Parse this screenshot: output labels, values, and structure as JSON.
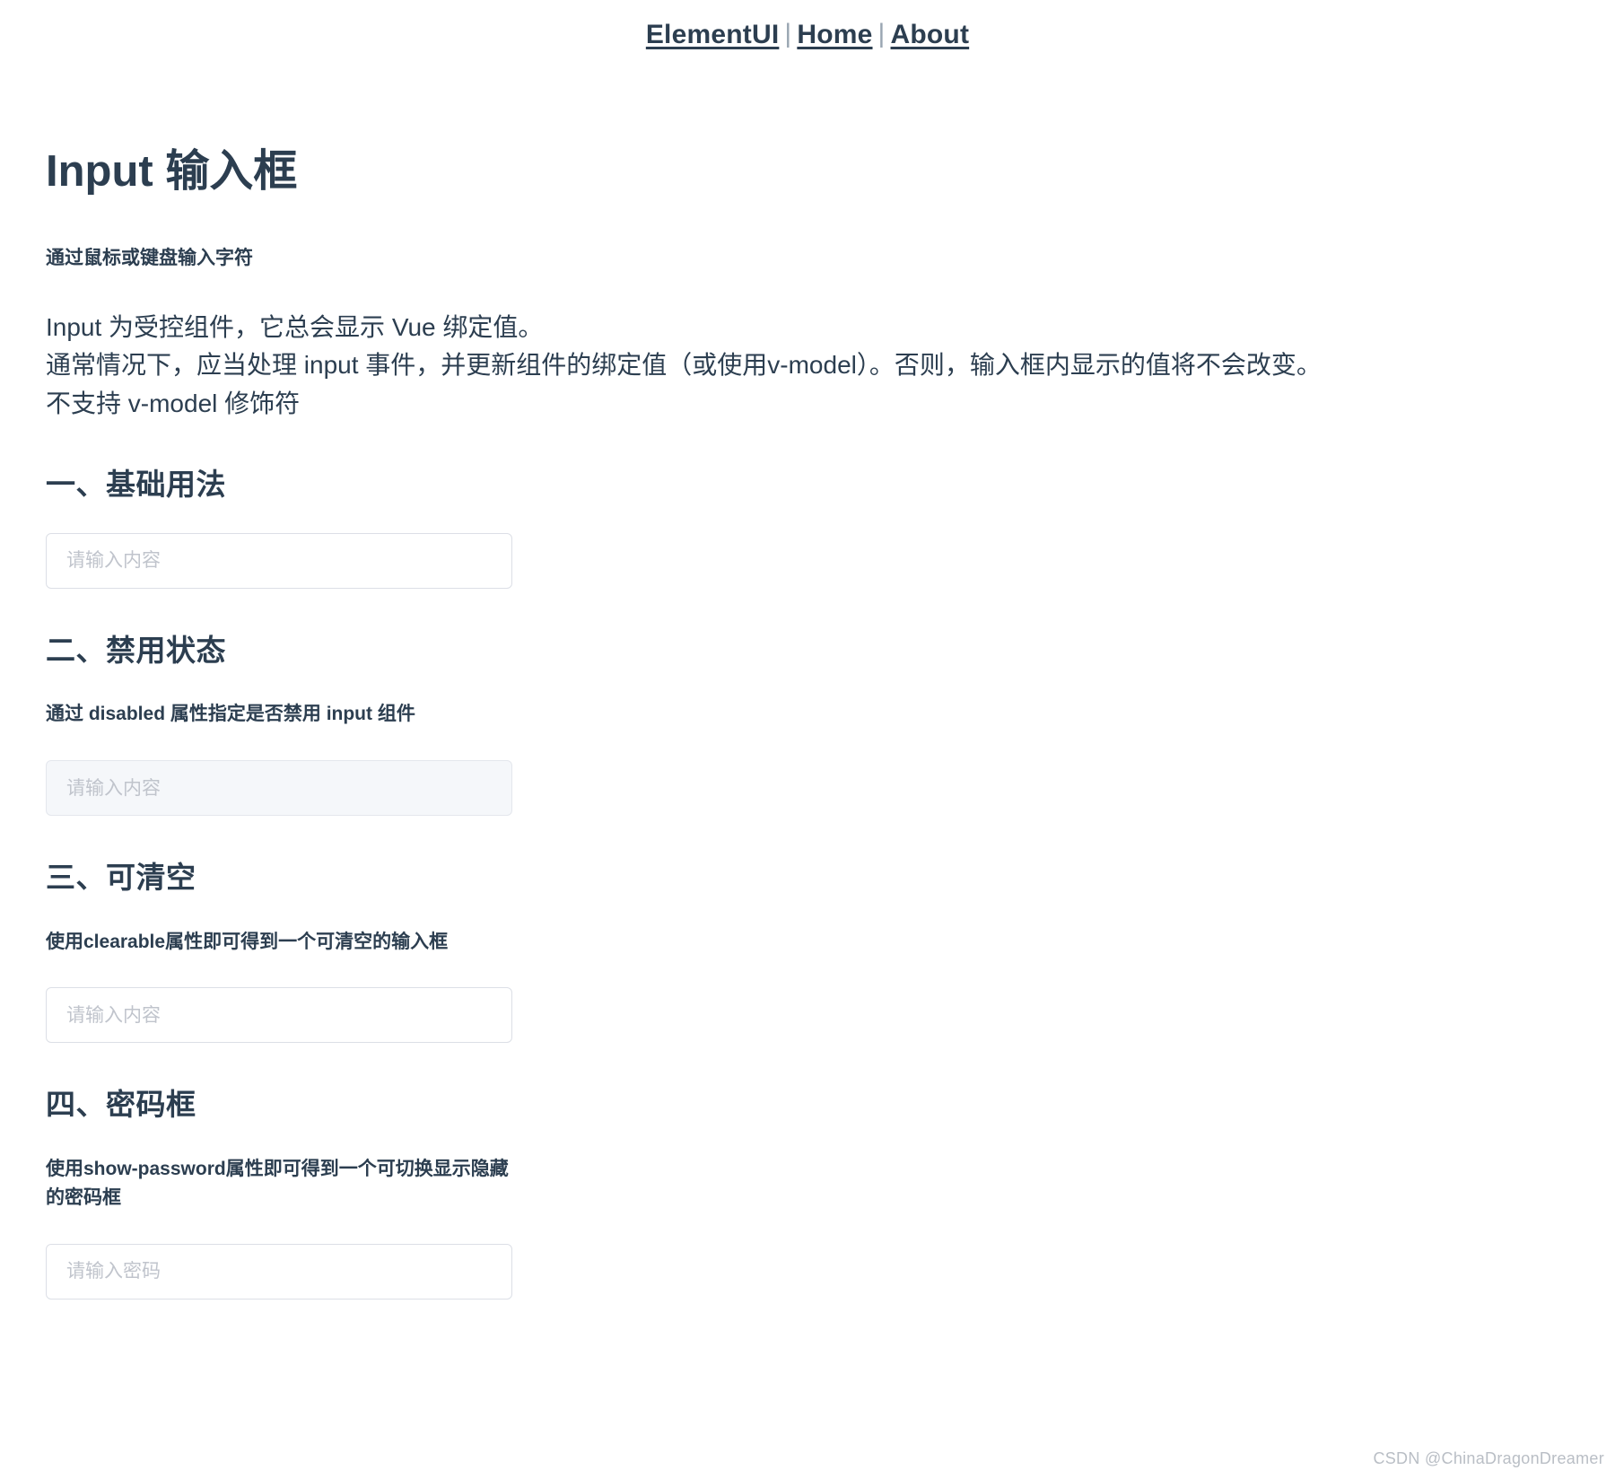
{
  "nav": {
    "separator": "|",
    "links": [
      {
        "label": "ElementUI"
      },
      {
        "label": "Home"
      },
      {
        "label": "About"
      }
    ]
  },
  "page": {
    "title": "Input 输入框",
    "lead": "通过鼠标或键盘输入字符",
    "description_lines": [
      "Input 为受控组件，它总会显示 Vue 绑定值。",
      "通常情况下，应当处理 input 事件，并更新组件的绑定值（或使用v-model）。否则，输入框内显示的值将不会改变。",
      "不支持 v-model 修饰符"
    ]
  },
  "sections": [
    {
      "title": "一、基础用法",
      "description": "",
      "input": {
        "placeholder": "请输入内容",
        "value": "",
        "disabled": false
      }
    },
    {
      "title": "二、禁用状态",
      "description": "通过 disabled 属性指定是否禁用 input 组件",
      "input": {
        "placeholder": "请输入内容",
        "value": "",
        "disabled": true
      }
    },
    {
      "title": "三、可清空",
      "description": "使用clearable属性即可得到一个可清空的输入框",
      "input": {
        "placeholder": "请输入内容",
        "value": "",
        "disabled": false
      }
    },
    {
      "title": "四、密码框",
      "description": "使用show-password属性即可得到一个可切换显示隐藏的密码框",
      "input": {
        "placeholder": "请输入密码",
        "value": "",
        "disabled": false
      }
    }
  ],
  "watermark": "CSDN @ChinaDragonDreamer",
  "colors": {
    "text": "#2c3e50",
    "placeholder": "#c0c4cc",
    "border": "#dcdfe6",
    "disabled_bg": "#f5f7fa",
    "watermark": "#b9bec5"
  }
}
